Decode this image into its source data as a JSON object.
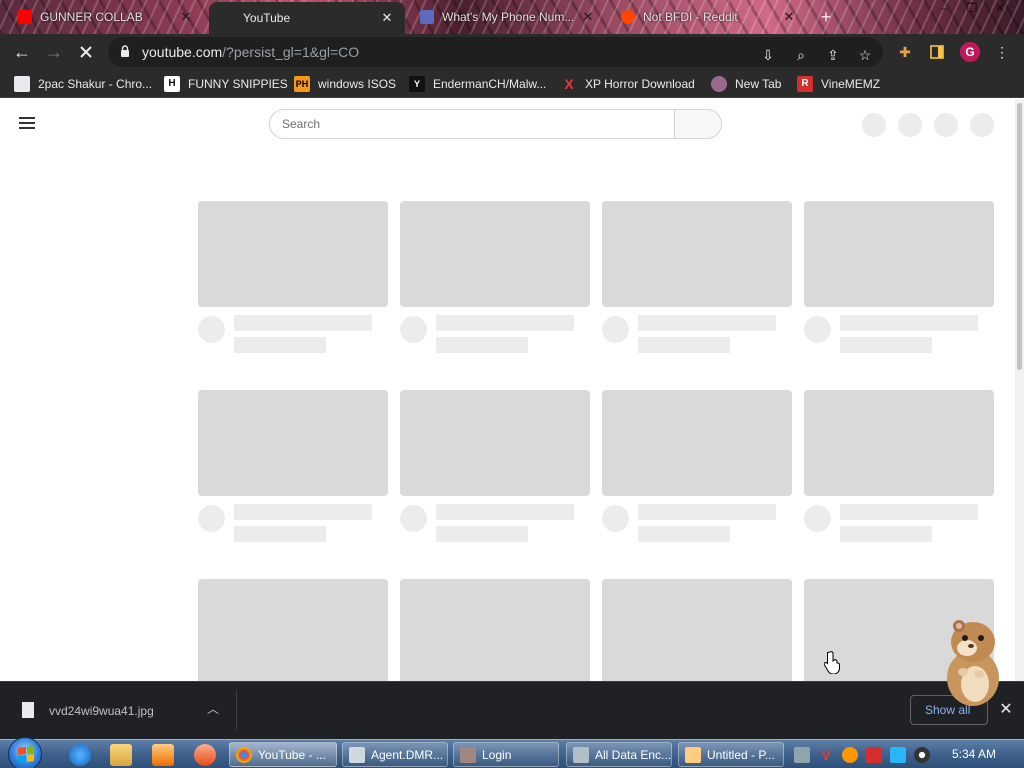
{
  "browser": {
    "tabs": [
      {
        "title": "GUNNER COLLAB",
        "active": false
      },
      {
        "title": "YouTube",
        "active": true
      },
      {
        "title": "What's My Phone Num...",
        "active": false
      },
      {
        "title": "Not BFDI - Reddit",
        "active": false
      }
    ],
    "new_tab_label": "+",
    "window_controls": {
      "minimize": "–",
      "restore": "❐",
      "close": "✕"
    },
    "url_host": "youtube.com",
    "url_rest": "/?persist_gl=1&gl=CO",
    "profile_initial": "G",
    "bookmarks": [
      {
        "label": "2pac Shakur - Chro...",
        "icon": "bookmark-site-icon",
        "color": "#e53935"
      },
      {
        "label": "FUNNY SNIPPIES",
        "icon": "H",
        "color": "#ffffff"
      },
      {
        "label": "windows ISOS",
        "icon": "PH",
        "color": "#f7971d"
      },
      {
        "label": "EndermanCH/Malw...",
        "icon": "Y",
        "color": "#111111"
      },
      {
        "label": "XP Horror Download",
        "icon": "X",
        "color": "#e53935"
      },
      {
        "label": "New Tab",
        "icon": "globe-icon",
        "color": "#9c6a8a"
      },
      {
        "label": "VineMEMZ",
        "icon": "R",
        "color": "#d32f2f"
      }
    ]
  },
  "youtube": {
    "search_placeholder": "Search",
    "grid_rows": 3,
    "grid_cols": 4
  },
  "download_bar": {
    "filename": "vvd24wi9wua41.jpg",
    "show_all_label": "Show all"
  },
  "taskbar": {
    "tasks": [
      {
        "label": "YouTube - ...",
        "active": true,
        "color": "#4285f4"
      },
      {
        "label": "Agent.DMR...",
        "active": false,
        "color": "#cfd8dc"
      },
      {
        "label": "Login",
        "active": false,
        "color": "#a1887f"
      },
      {
        "label": "All Data Enc...",
        "active": false,
        "color": "#b0bec5"
      },
      {
        "label": "Untitled - P...",
        "active": false,
        "color": "#ffcc80"
      }
    ],
    "clock": "5:34 AM"
  },
  "colors": {
    "browser_chrome": "#2b2b2b",
    "placeholder_gray": "#d9d9d9",
    "link_blue": "#8ab4f8",
    "profile_pink": "#c2185b"
  }
}
